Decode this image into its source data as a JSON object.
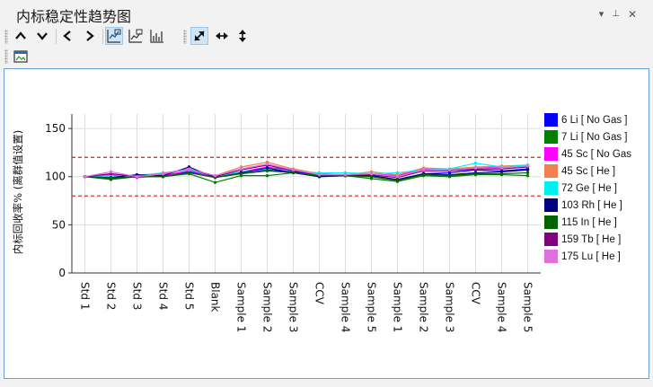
{
  "window": {
    "title": "内标稳定性趋势图"
  },
  "title_buttons": {
    "dropdown": "▾",
    "pin": "⊥",
    "close": "✕"
  },
  "toolbar": {
    "buttons": [
      {
        "name": "scroll-up-button",
        "icon": "chevron-up-icon"
      },
      {
        "name": "scroll-down-button",
        "icon": "chevron-down-icon"
      },
      {
        "name": "previous-button",
        "icon": "chevron-left-icon"
      },
      {
        "name": "next-button",
        "icon": "chevron-right-icon"
      },
      {
        "name": "line-chart-view-button",
        "icon": "line-chart-icon",
        "active": true
      },
      {
        "name": "line-chart-alt-view-button",
        "icon": "line-chart-alt-icon",
        "active": false
      },
      {
        "name": "bar-chart-view-button",
        "icon": "bar-chart-icon",
        "active": false
      },
      {
        "name": "zoom-fit-button",
        "icon": "diagonal-expand-icon",
        "active": true
      },
      {
        "name": "zoom-horizontal-button",
        "icon": "horizontal-expand-icon"
      },
      {
        "name": "zoom-vertical-button",
        "icon": "vertical-expand-icon"
      }
    ]
  },
  "toolbar2": {
    "buttons": [
      {
        "name": "export-image-button",
        "icon": "image-icon"
      }
    ]
  },
  "colors": {
    "panel_border": "#6e9fd0",
    "limit_line": "#d42020",
    "grid": "#dddddd"
  },
  "chart_data": {
    "type": "line",
    "title": "",
    "xlabel": "",
    "ylabel": "内标回收率% (离群值设置)",
    "ylim": [
      0,
      165
    ],
    "yticks": [
      0,
      50,
      100,
      150
    ],
    "grid": true,
    "legend_position": "right",
    "limits": [
      80,
      120
    ],
    "categories": [
      "Std 1",
      "Std 2",
      "Std 3",
      "Std 4",
      "Std 5",
      "Blank",
      "Sample 1",
      "Sample 2",
      "Sample 3",
      "CCV",
      "Sample 4",
      "Sample 5",
      "Sample 1",
      "Sample 2",
      "Sample 3",
      "CCV",
      "Sample 4",
      "Sample 5"
    ],
    "series": [
      {
        "name": "6 Li [ No Gas ]",
        "color": "#0000ff",
        "values": [
          100,
          98,
          101,
          101,
          105,
          100,
          103,
          107,
          105,
          102,
          101,
          101,
          97,
          103,
          104,
          107,
          106,
          108
        ]
      },
      {
        "name": "7 Li [ No Gas ]",
        "color": "#008000",
        "values": [
          100,
          97,
          100,
          100,
          103,
          94,
          101,
          101,
          104,
          100,
          101,
          98,
          95,
          101,
          100,
          102,
          102,
          101
        ]
      },
      {
        "name": "45 Sc [ No Gas",
        "color": "#ff00ff",
        "values": [
          100,
          102,
          99,
          101,
          106,
          100,
          105,
          110,
          106,
          103,
          102,
          103,
          101,
          108,
          107,
          109,
          110,
          111
        ]
      },
      {
        "name": "45 Sc [ He ]",
        "color": "#f08050",
        "values": [
          100,
          101,
          100,
          102,
          108,
          101,
          110,
          115,
          108,
          103,
          102,
          105,
          102,
          109,
          108,
          110,
          111,
          112
        ]
      },
      {
        "name": "72 Ge [ He ]",
        "color": "#00f0f0",
        "values": [
          100,
          100,
          101,
          104,
          107,
          100,
          105,
          108,
          106,
          104,
          104,
          103,
          104,
          107,
          108,
          114,
          110,
          112
        ]
      },
      {
        "name": "103 Rh [ He ]",
        "color": "#000080",
        "values": [
          100,
          99,
          102,
          101,
          110,
          99,
          104,
          109,
          104,
          100,
          101,
          101,
          97,
          103,
          102,
          104,
          105,
          107
        ]
      },
      {
        "name": "115 In [ He ]",
        "color": "#006400",
        "values": [
          100,
          98,
          100,
          100,
          104,
          99,
          103,
          106,
          104,
          101,
          101,
          100,
          96,
          102,
          101,
          103,
          103,
          104
        ]
      },
      {
        "name": "159 Tb [ He ]",
        "color": "#800080",
        "values": [
          100,
          103,
          100,
          103,
          108,
          100,
          107,
          112,
          106,
          102,
          102,
          102,
          99,
          106,
          106,
          108,
          108,
          110
        ]
      },
      {
        "name": "175 Lu [ He ]",
        "color": "#e070e0",
        "values": [
          100,
          105,
          100,
          103,
          108,
          101,
          108,
          113,
          107,
          102,
          102,
          103,
          100,
          107,
          107,
          109,
          109,
          111
        ]
      }
    ]
  }
}
